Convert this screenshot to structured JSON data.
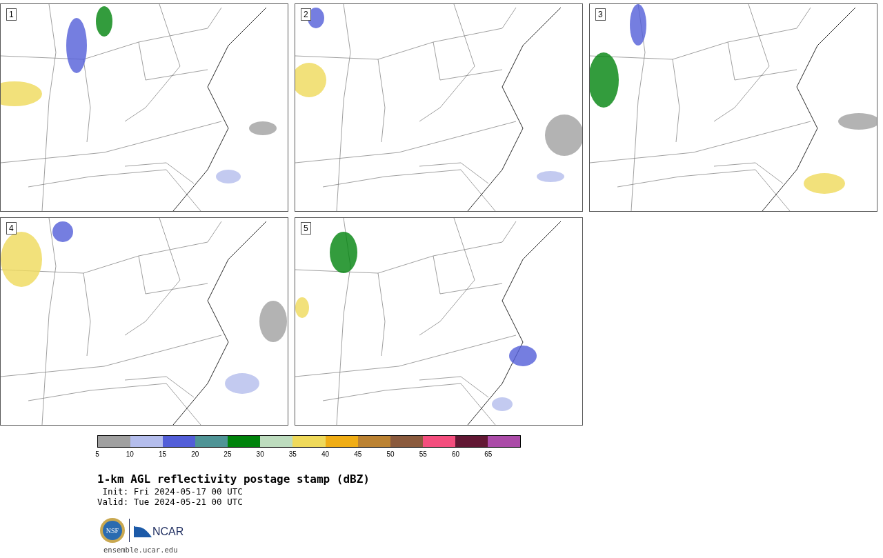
{
  "panels": [
    {
      "label": "1"
    },
    {
      "label": "2"
    },
    {
      "label": "3"
    },
    {
      "label": "4"
    },
    {
      "label": "5"
    }
  ],
  "colorbar": {
    "segments": [
      {
        "color": "#a0a0a0"
      },
      {
        "color": "#b4bdec"
      },
      {
        "color": "#525ed8"
      },
      {
        "color": "#4f9496"
      },
      {
        "color": "#00830c"
      },
      {
        "color": "#bddcbe"
      },
      {
        "color": "#efd95a"
      },
      {
        "color": "#f0ad15"
      },
      {
        "color": "#bb8232"
      },
      {
        "color": "#8a5a3d"
      },
      {
        "color": "#f44e7e"
      },
      {
        "color": "#621834"
      },
      {
        "color": "#ab4ba8"
      }
    ],
    "ticks": [
      "5",
      "10",
      "15",
      "20",
      "25",
      "30",
      "35",
      "40",
      "45",
      "50",
      "55",
      "60",
      "65"
    ]
  },
  "title": "1-km AGL reflectivity postage stamp (dBZ)",
  "init": " Init: Fri 2024-05-17 00 UTC",
  "valid": "Valid: Tue 2024-05-21 00 UTC",
  "logos": {
    "nsf": "NSF",
    "ncar": "NCAR"
  },
  "url": "ensemble.ucar.edu"
}
